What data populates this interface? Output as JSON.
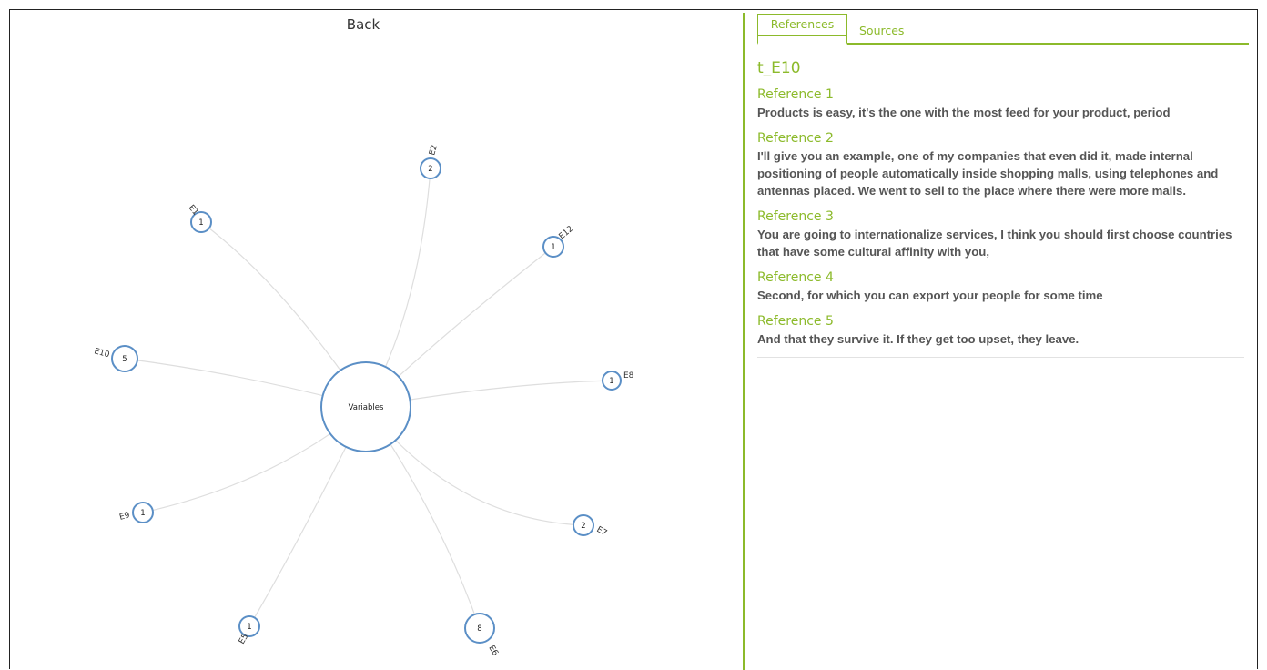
{
  "nav": {
    "back_label": "Back"
  },
  "diagram": {
    "center": {
      "label": "Variables"
    },
    "nodes": [
      {
        "id": "E2",
        "label": "E2",
        "count": "2"
      },
      {
        "id": "E12",
        "label": "E12",
        "count": "1"
      },
      {
        "id": "E8",
        "label": "E8",
        "count": "1"
      },
      {
        "id": "E7",
        "label": "E7",
        "count": "2"
      },
      {
        "id": "E6",
        "label": "E6",
        "count": "8"
      },
      {
        "id": "E5",
        "label": "E5",
        "count": "1"
      },
      {
        "id": "E9",
        "label": "E9",
        "count": "1"
      },
      {
        "id": "E10",
        "label": "E10",
        "count": "5"
      },
      {
        "id": "E1",
        "label": "E1",
        "count": "1"
      }
    ]
  },
  "tabs": {
    "references": "References",
    "sources": "Sources"
  },
  "detail": {
    "title": "t_E10",
    "references": [
      {
        "title": "Reference 1",
        "text": "Products is easy, it's the one with the most feed for your product, period"
      },
      {
        "title": "Reference 2",
        "text": "I'll give you an example, one of my companies that even did it, made internal positioning of people automatically inside shopping malls, using telephones and antennas placed. We went to sell to the place where there were more malls."
      },
      {
        "title": "Reference 3",
        "text": "You are going to internationalize services, I think you should first choose countries that have some cultural affinity with you,"
      },
      {
        "title": "Reference 4",
        "text": "Second, for which you can export your people for some time"
      },
      {
        "title": "Reference 5",
        "text": "And that they survive it. If they get too upset, they leave."
      }
    ]
  }
}
